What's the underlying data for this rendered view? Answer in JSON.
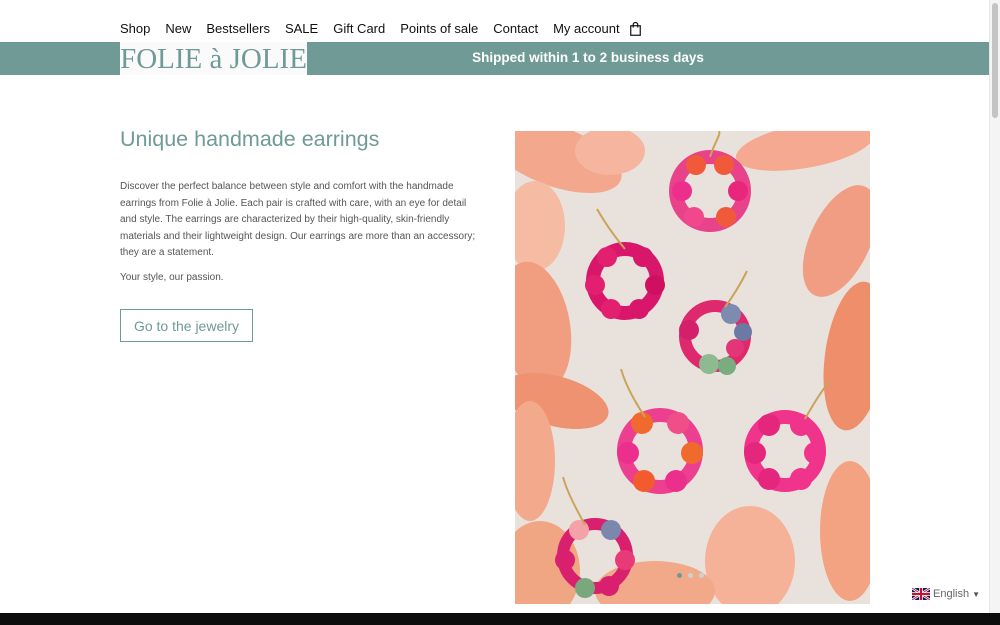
{
  "nav": {
    "items": [
      "Shop",
      "New",
      "Bestsellers",
      "SALE",
      "Gift Card",
      "Points of sale",
      "Contact",
      "My account"
    ],
    "cart_icon": "shopping-bag-icon"
  },
  "brand": {
    "logo_text": "FOLIE à JOLIE"
  },
  "banner": {
    "text": "Shipped within 1 to 2 business days"
  },
  "content": {
    "heading": "Unique handmade earrings",
    "description": "Discover the perfect balance between style and comfort with the handmade earrings from Folie à Jolie. Each pair is crafted with care, with an eye for detail and style. The earrings are characterized by their high-quality, skin-friendly materials and their lightweight design.  Our earrings are more than an accessory; they are a statement.",
    "tagline": "Your style, our passion.",
    "cta_label": "Go to the jewelry"
  },
  "carousel": {
    "slides": 3,
    "active_index": 0
  },
  "language": {
    "label": "English",
    "flag_icon": "uk-flag-icon",
    "caret": "▼"
  },
  "colors": {
    "accent": "#6f9a96",
    "footer": "#0d0d0d"
  }
}
